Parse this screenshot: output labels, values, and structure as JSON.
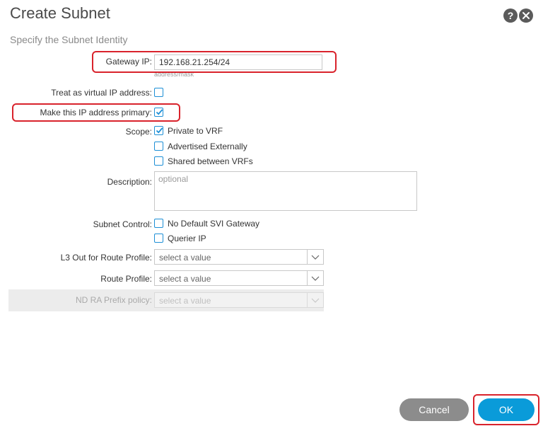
{
  "dialog": {
    "title": "Create Subnet",
    "subtitle": "Specify the Subnet Identity"
  },
  "form": {
    "gateway_ip": {
      "label": "Gateway IP:",
      "value": "192.168.21.254/24",
      "hint": "address/mask"
    },
    "virtual_ip": {
      "label": "Treat as virtual IP address:",
      "checked": false
    },
    "primary": {
      "label": "Make this IP address primary:",
      "checked": true
    },
    "scope": {
      "label": "Scope:",
      "options": [
        {
          "label": "Private to VRF",
          "checked": true
        },
        {
          "label": "Advertised Externally",
          "checked": false
        },
        {
          "label": "Shared between VRFs",
          "checked": false
        }
      ]
    },
    "description": {
      "label": "Description:",
      "placeholder": "optional"
    },
    "subnet_control": {
      "label": "Subnet Control:",
      "options": [
        {
          "label": "No Default SVI Gateway",
          "checked": false
        },
        {
          "label": "Querier IP",
          "checked": false
        }
      ]
    },
    "l3out_route_profile": {
      "label": "L3 Out for Route Profile:",
      "value": "select a value"
    },
    "route_profile": {
      "label": "Route Profile:",
      "value": "select a value"
    },
    "nd_ra_prefix_policy": {
      "label": "ND RA Prefix policy:",
      "value": "select a value"
    }
  },
  "buttons": {
    "cancel": "Cancel",
    "ok": "OK"
  },
  "colors": {
    "accent": "#0a9bd9",
    "highlight": "#d9232c",
    "cancel": "#8c8c8c",
    "checkbox": "#1d8fd6"
  }
}
